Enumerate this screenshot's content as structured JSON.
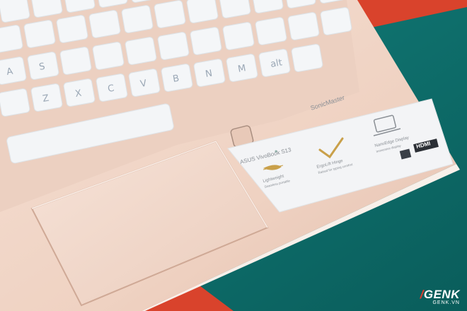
{
  "brand_mark": "SonicMaster",
  "keys": [
    "A",
    "S",
    "Z",
    "X",
    "C",
    "V",
    "B",
    "N",
    "M",
    "alt"
  ],
  "sticker": {
    "model": "ASUS VivoBook S13",
    "features": [
      {
        "title": "Lightweight",
        "sub": "Seamless portable"
      },
      {
        "title": "ErgoLift Hinge",
        "sub": "Raised for typing comfort"
      },
      {
        "title": "NanoEdge Display",
        "sub": "Immersive display"
      }
    ],
    "hdmi": "HDMI"
  },
  "watermark": {
    "logo": "GENK",
    "url": "GENK.VN"
  },
  "colors": {
    "chassis": "#f2d6c8",
    "keys": "#f4f6f8",
    "background_teal": "#0f6f6c",
    "background_red": "#d9432c"
  }
}
